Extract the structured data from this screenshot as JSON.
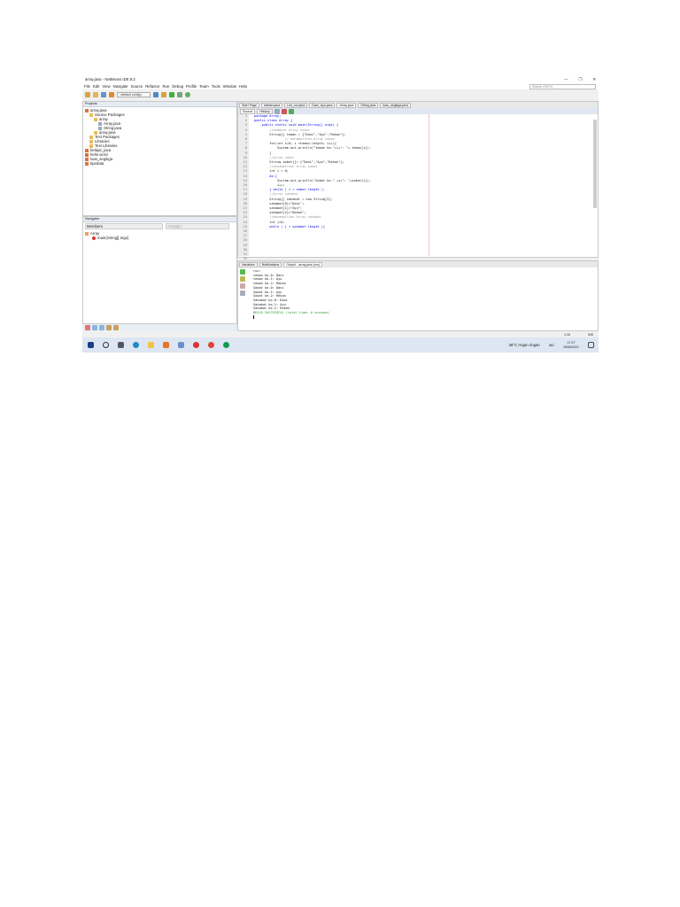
{
  "window": {
    "title": "array.java - NetBeans IDE 8.2",
    "search_placeholder": "Search (Ctrl+I)",
    "controls": [
      "—",
      "❐",
      "✕"
    ]
  },
  "menu": [
    "File",
    "Edit",
    "View",
    "Navigate",
    "Source",
    "Refactor",
    "Run",
    "Debug",
    "Profile",
    "Team",
    "Tools",
    "Window",
    "Help"
  ],
  "toolbar": {
    "config": "<default config>"
  },
  "projects": {
    "title": "Projects",
    "items": [
      {
        "label": "array.java",
        "depth": 0
      },
      {
        "label": "Source Packages",
        "depth": 1
      },
      {
        "label": "array",
        "depth": 2
      },
      {
        "label": "Array.java",
        "depth": 3
      },
      {
        "label": "String.java",
        "depth": 3
      },
      {
        "label": "array.java",
        "depth": 2
      },
      {
        "label": "Test Packages",
        "depth": 1
      },
      {
        "label": "Libraries",
        "depth": 1
      },
      {
        "label": "Test Libraries",
        "depth": 1
      },
      {
        "label": "belajar_java",
        "depth": 0
      },
      {
        "label": "hello word",
        "depth": 0
      },
      {
        "label": "luas_segitiga",
        "depth": 0
      },
      {
        "label": "tipedata",
        "depth": 0
      }
    ]
  },
  "navigator": {
    "title": "Navigator",
    "filter": "Members",
    "empty": "<empty>",
    "class": "Array",
    "method": "main(String[] args)"
  },
  "editor": {
    "tabs": [
      "Start Page",
      "latihan.java",
      "List_out.java",
      "Dani_Ayu.java",
      "Array.java",
      "String.java",
      "luas_segitiga.java"
    ],
    "active_tab": 4,
    "subtabs": [
      "Source",
      "History"
    ],
    "lines": [
      {
        "c": "kw",
        "t": "package Array;"
      },
      {
        "c": "kw",
        "t": "public class Array {"
      },
      {
        "c": "kw",
        "t": "    public static void main(String[] args) {"
      },
      {
        "c": "cm",
        "t": "        //membuat array teman"
      },
      {
        "c": "nm",
        "t": "        String[] teman = {\"Dani\",\"Ayu\",\"Rekan\"};"
      },
      {
        "c": "nm",
        "t": ""
      },
      {
        "c": "cm",
        "t": "                // menampilkan Array teman"
      },
      {
        "c": "nm",
        "t": "        for(int i=0; i <teman.length; i++){"
      },
      {
        "c": "nm",
        "t": "            System.out.println(\"teman ke-\"+i+\": \"+ teman[i]);"
      },
      {
        "c": "nm",
        "t": "        }"
      },
      {
        "c": "nm",
        "t": ""
      },
      {
        "c": "nm",
        "t": ""
      },
      {
        "c": "nm",
        "t": ""
      },
      {
        "c": "cm",
        "t": "        //Array sobat"
      },
      {
        "c": "nm",
        "t": "        String sobat[]= {\"Dani\",\"Ayu\",\"Rekan\"};"
      },
      {
        "c": "nm",
        "t": ""
      },
      {
        "c": "cm",
        "t": "        //menampilkan Array sobat"
      },
      {
        "c": "nm",
        "t": "        int i = 0;"
      },
      {
        "c": "kw",
        "t": "        do {"
      },
      {
        "c": "nm",
        "t": "            System.out.println(\"Sobat ke-\" +i+\": \"+sobat[i]);"
      },
      {
        "c": "nm",
        "t": "            i++;"
      },
      {
        "c": "kw",
        "t": "        } while ( i < sobat.length );"
      },
      {
        "c": "nm",
        "t": ""
      },
      {
        "c": "cm",
        "t": "        //Array sahabat"
      },
      {
        "c": "nm",
        "t": "        String[] sahabat = new String[3];"
      },
      {
        "c": "nm",
        "t": "        sahabat[0]=\"Dani\";"
      },
      {
        "c": "nm",
        "t": "        sahabat[1]=\"Ayu\";"
      },
      {
        "c": "nm",
        "t": "        sahabat[2]=\"Rekan\";"
      },
      {
        "c": "nm",
        "t": ""
      },
      {
        "c": "cm",
        "t": "        //menampilkan Array sahabat"
      },
      {
        "c": "nm",
        "t": "        int j=0;"
      },
      {
        "c": "kw",
        "t": "        while ( j < sahabat.length ){"
      }
    ]
  },
  "output": {
    "tabs": [
      "Variables",
      "Notifications",
      "Output - array.java (run)"
    ],
    "lines": [
      "run:",
      "teman ke-0: Dani",
      "teman ke-1: Ayu",
      "teman ke-2: Rekan",
      "Sobat ke-0: Dani",
      "Sobat ke-1: Ayu",
      "Sobat ke-2: Rekan",
      "Sahabat ke-0: Dani",
      "Sahabat ke-1: Ayu",
      "Sahabat ke-2: Rekan"
    ],
    "build": "BUILD SUCCESSFUL (total time: 0 seconds)"
  },
  "status": {
    "position": "1:15",
    "mode": "INS"
  },
  "taskbar": {
    "weather": "28°C  Hujan ringan",
    "lang": "IND",
    "time": "17:27",
    "date": "15/06/2021"
  }
}
